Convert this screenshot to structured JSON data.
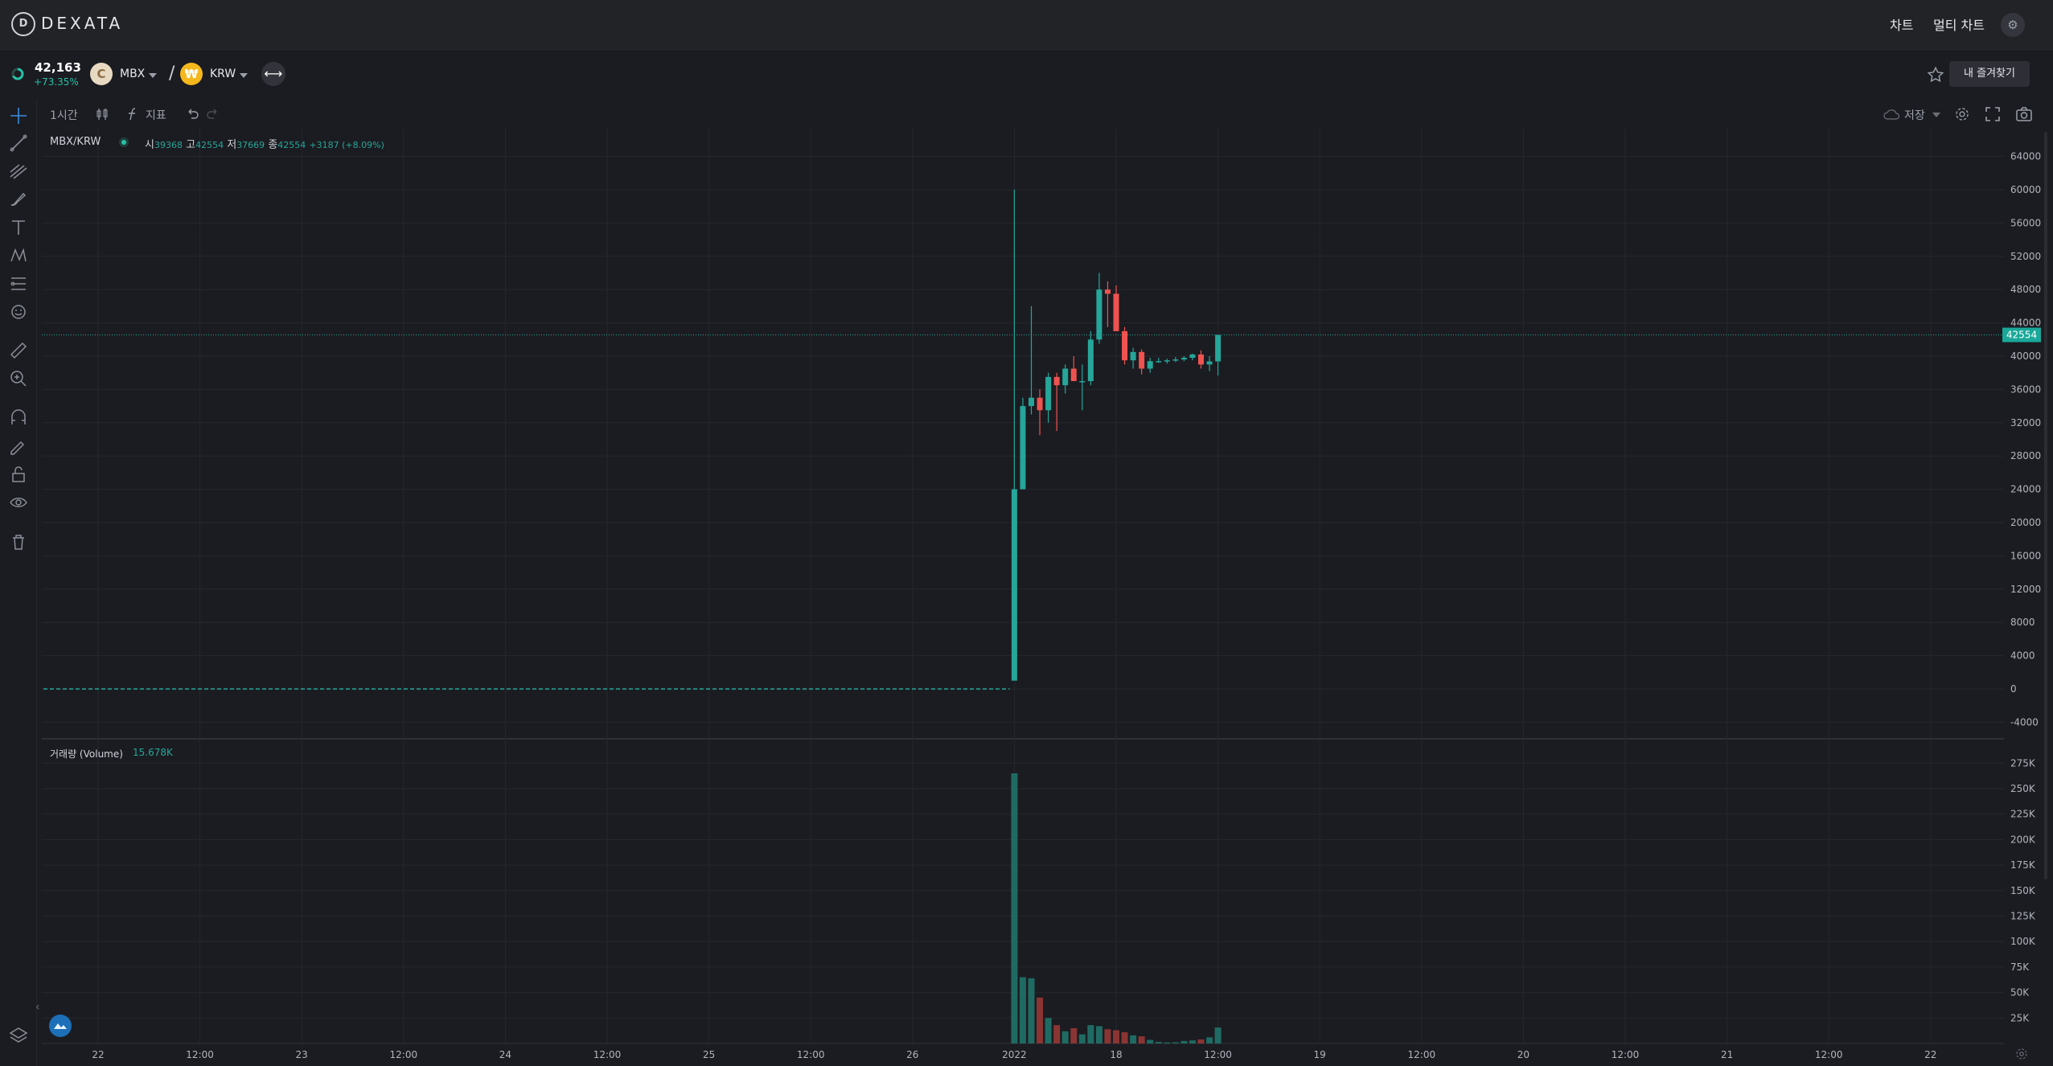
{
  "app": {
    "logo_mark": "D",
    "logo_text": "DEXATA",
    "nav": {
      "chart": "차트",
      "multi_chart": "멀티 차트"
    },
    "settings_glyph": "⚙"
  },
  "ticker": {
    "price": "42,163",
    "change": "+73.35%",
    "base_symbol": "MBX",
    "base_icon_glyph": "C",
    "separator": "/",
    "quote_symbol": "KRW",
    "quote_icon_glyph": "₩",
    "swap_glyph": "⟷",
    "favorites_label": "내 즐겨찾기"
  },
  "toolbar": {
    "interval": "1시간",
    "indicators": "지표",
    "save": "저장"
  },
  "legend": {
    "pair": "MBX/KRW",
    "o_label": "시",
    "o_value": "39368",
    "h_label": "고",
    "h_value": "42554",
    "l_label": "저",
    "l_value": "37669",
    "c_label": "종",
    "c_value": "42554",
    "change": "+3187 (+8.09%)"
  },
  "volume_legend": {
    "label": "거래량 (Volume)",
    "value": "15.678K"
  },
  "colors": {
    "up": "#26a69a",
    "down": "#ef5350",
    "bg": "#1b1c21",
    "grid": "#26272d",
    "accent": "#1aa89a"
  },
  "chart_data": {
    "type": "candlestick",
    "pair": "MBX/KRW",
    "last_price_label": "42554",
    "price_axis_ticks": [
      64000,
      60000,
      56000,
      52000,
      48000,
      44000,
      40000,
      36000,
      32000,
      28000,
      24000,
      20000,
      16000,
      12000,
      8000,
      4000,
      0,
      -4000
    ],
    "price_axis_labels": [
      "64000",
      "60000",
      "56000",
      "52000",
      "48000",
      "44000",
      "40000",
      "36000",
      "32000",
      "28000",
      "24000",
      "20000",
      "16000",
      "12000",
      "8000",
      "4000",
      "0",
      "-4000"
    ],
    "volume_axis_labels": [
      "275K",
      "250K",
      "225K",
      "200K",
      "175K",
      "150K",
      "125K",
      "100K",
      "75K",
      "50K",
      "25K"
    ],
    "volume_axis_values": [
      275000,
      250000,
      225000,
      200000,
      175000,
      150000,
      125000,
      100000,
      75000,
      50000,
      25000
    ],
    "time_axis_labels": [
      "22",
      "12:00",
      "23",
      "12:00",
      "24",
      "12:00",
      "25",
      "12:00",
      "26",
      "2022",
      "18",
      "12:00",
      "19",
      "12:00",
      "20",
      "12:00",
      "21",
      "12:00",
      "22"
    ],
    "time_axis_hours": [
      0,
      12,
      24,
      36,
      48,
      60,
      72,
      84,
      96,
      108,
      120,
      132,
      144,
      156,
      168,
      180,
      192,
      204,
      216
    ],
    "pre_listing_line_value": 0,
    "candles": [
      {
        "h": 108,
        "o": 1000,
        "hi": 60000,
        "l": 1000,
        "c": 24000,
        "v": 265000
      },
      {
        "h": 109,
        "o": 24000,
        "hi": 35000,
        "l": 24000,
        "c": 34000,
        "v": 65000
      },
      {
        "h": 110,
        "o": 34000,
        "hi": 46000,
        "l": 33000,
        "c": 35000,
        "v": 64000
      },
      {
        "h": 111,
        "o": 35000,
        "hi": 36000,
        "l": 30500,
        "c": 33500,
        "v": 45000
      },
      {
        "h": 112,
        "o": 33500,
        "hi": 38000,
        "l": 32000,
        "c": 37500,
        "v": 25000
      },
      {
        "h": 113,
        "o": 37500,
        "hi": 38000,
        "l": 31000,
        "c": 36500,
        "v": 18000
      },
      {
        "h": 114,
        "o": 36500,
        "hi": 39000,
        "l": 35500,
        "c": 38500,
        "v": 12000
      },
      {
        "h": 115,
        "o": 38500,
        "hi": 40000,
        "l": 37500,
        "c": 37000,
        "v": 15000
      },
      {
        "h": 116,
        "o": 37000,
        "hi": 39000,
        "l": 33500,
        "c": 37000,
        "v": 9000
      },
      {
        "h": 117,
        "o": 37000,
        "hi": 43000,
        "l": 36500,
        "c": 42000,
        "v": 18000
      },
      {
        "h": 118,
        "o": 42000,
        "hi": 50000,
        "l": 41500,
        "c": 48000,
        "v": 17000
      },
      {
        "h": 119,
        "o": 48000,
        "hi": 49000,
        "l": 43500,
        "c": 47500,
        "v": 14000
      },
      {
        "h": 120,
        "o": 47500,
        "hi": 48500,
        "l": 43000,
        "c": 43000,
        "v": 13000
      },
      {
        "h": 121,
        "o": 43000,
        "hi": 43500,
        "l": 39000,
        "c": 39500,
        "v": 11000
      },
      {
        "h": 122,
        "o": 39500,
        "hi": 41000,
        "l": 38500,
        "c": 40500,
        "v": 8000
      },
      {
        "h": 123,
        "o": 40500,
        "hi": 40800,
        "l": 37800,
        "c": 38500,
        "v": 7000
      },
      {
        "h": 124,
        "o": 38500,
        "hi": 39800,
        "l": 38000,
        "c": 39400,
        "v": 3500
      },
      {
        "h": 125,
        "o": 39400,
        "hi": 39800,
        "l": 39200,
        "c": 39400,
        "v": 1500
      },
      {
        "h": 126,
        "o": 39400,
        "hi": 39700,
        "l": 39100,
        "c": 39500,
        "v": 1000
      },
      {
        "h": 127,
        "o": 39500,
        "hi": 39900,
        "l": 39300,
        "c": 39600,
        "v": 1200
      },
      {
        "h": 128,
        "o": 39600,
        "hi": 40000,
        "l": 39400,
        "c": 39800,
        "v": 2500
      },
      {
        "h": 129,
        "o": 39800,
        "hi": 40300,
        "l": 39500,
        "c": 40200,
        "v": 3000
      },
      {
        "h": 130,
        "o": 40200,
        "hi": 40700,
        "l": 38500,
        "c": 39000,
        "v": 4000
      },
      {
        "h": 131,
        "o": 39000,
        "hi": 40000,
        "l": 38200,
        "c": 39368,
        "v": 6000
      },
      {
        "h": 132,
        "o": 39368,
        "hi": 42554,
        "l": 37669,
        "c": 42554,
        "v": 15678
      }
    ]
  }
}
